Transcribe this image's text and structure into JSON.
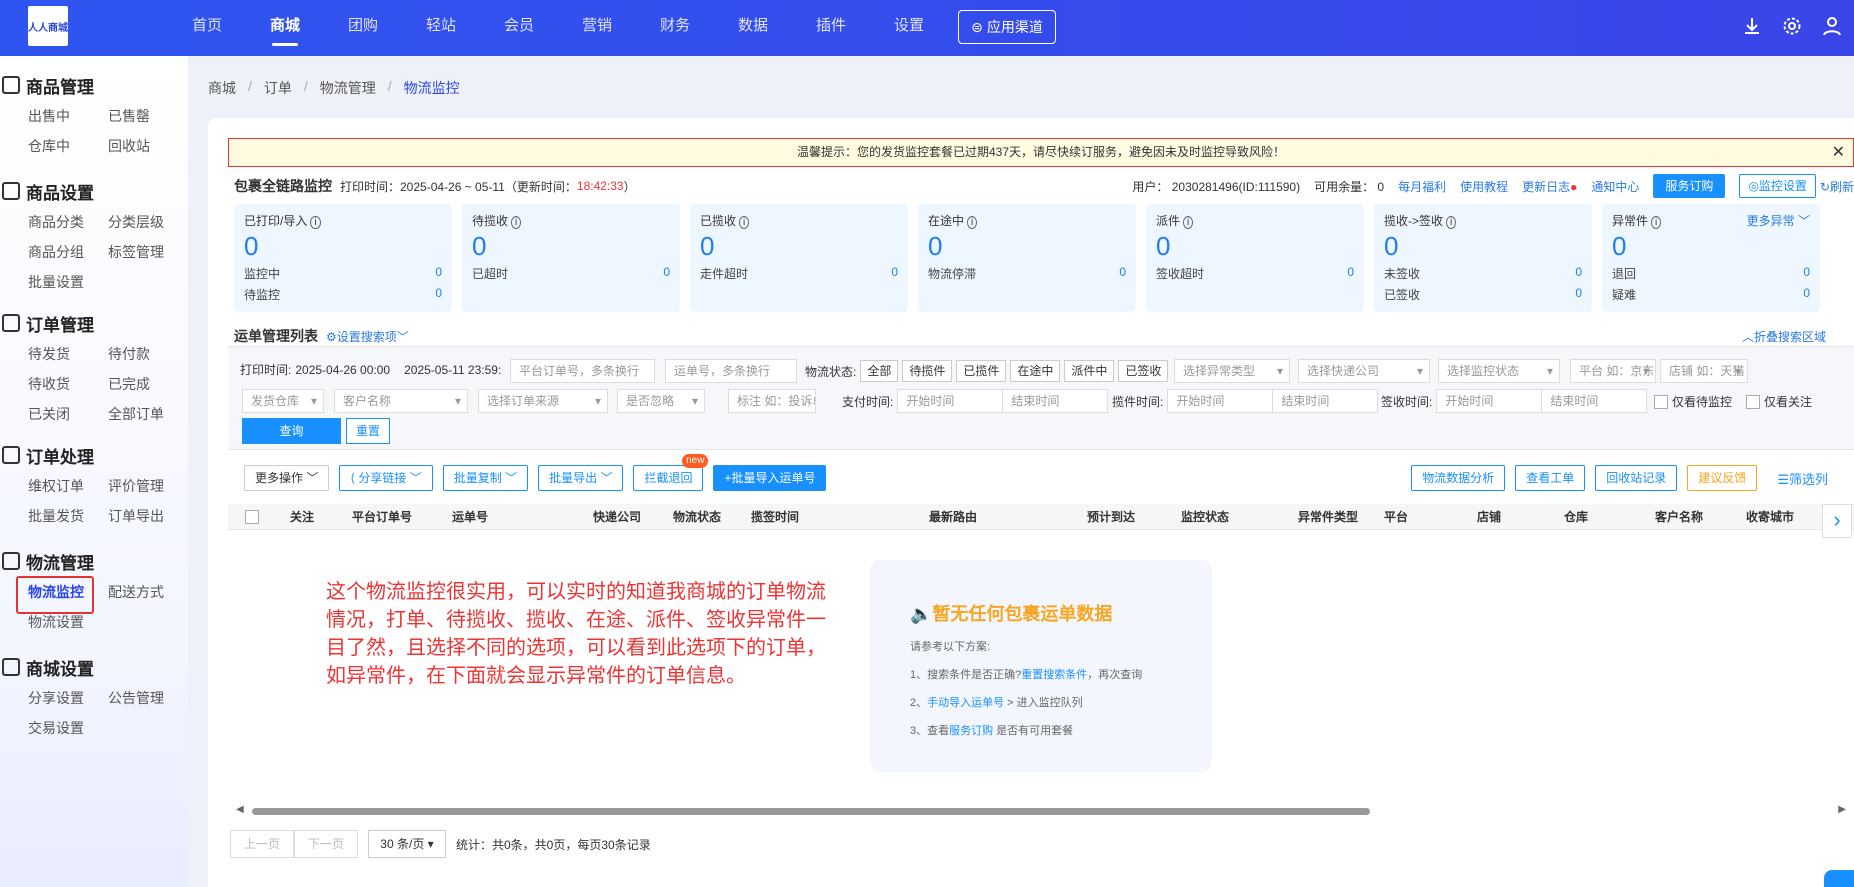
{
  "topbar": {
    "logo": "人人商城",
    "nav": [
      "首页",
      "商城",
      "团购",
      "轻站",
      "会员",
      "营销",
      "财务",
      "数据",
      "插件",
      "设置"
    ],
    "active": "商城",
    "app_button": "应用渠道",
    "icons": [
      "download-icon",
      "gear-icon",
      "user-icon"
    ]
  },
  "sidebar": {
    "sections": [
      {
        "title": "商品管理",
        "icon": "shop-icon",
        "items": [
          "出售中",
          "已售罄",
          "仓库中",
          "回收站"
        ]
      },
      {
        "title": "商品设置",
        "icon": "layers-icon",
        "items": [
          "商品分类",
          "分类层级",
          "商品分组",
          "标签管理",
          "批量设置"
        ]
      },
      {
        "title": "订单管理",
        "icon": "order-icon",
        "items": [
          "待发货",
          "待付款",
          "待收货",
          "已完成",
          "已关闭",
          "全部订单"
        ]
      },
      {
        "title": "订单处理",
        "icon": "document-icon",
        "items": [
          "维权订单",
          "评价管理",
          "批量发货",
          "订单导出"
        ]
      },
      {
        "title": "物流管理",
        "icon": "truck-icon",
        "items": [
          "物流监控",
          "配送方式",
          "物流设置"
        ],
        "active": "物流监控"
      },
      {
        "title": "商城设置",
        "icon": "settings-box-icon",
        "items": [
          "分享设置",
          "公告管理",
          "交易设置"
        ]
      }
    ]
  },
  "breadcrumb": [
    "商城",
    "订单",
    "物流管理",
    "物流监控"
  ],
  "warning": "温馨提示：您的发货监控套餐已过期437天，请尽快续订服务，避免因未及时监控导致风险！",
  "header": {
    "title": "包裹全链路监控",
    "print_time_label": "打印时间：2025-04-26 ~ 05-11",
    "update_label": "（更新时间：",
    "update_time": "18:42:33",
    "update_close": "）"
  },
  "right_info": {
    "user": "用户： 2030281496(ID:111590)",
    "balance": "可用余量： 0",
    "links": [
      "每月福利",
      "使用教程",
      "更新日志",
      "通知中心"
    ],
    "subscribe": "服务订购",
    "monitor_settings": "◎监控设置",
    "refresh": "刷新"
  },
  "cards": [
    {
      "title": "已打印/导入",
      "value": "0",
      "rows": [
        [
          "监控中",
          "0"
        ],
        [
          "待监控",
          "0"
        ]
      ]
    },
    {
      "title": "待揽收",
      "value": "0",
      "rows": [
        [
          "已超时",
          "0"
        ]
      ]
    },
    {
      "title": "已揽收",
      "value": "0",
      "rows": [
        [
          "走件超时",
          "0"
        ]
      ]
    },
    {
      "title": "在途中",
      "value": "0",
      "rows": [
        [
          "物流停滞",
          "0"
        ]
      ]
    },
    {
      "title": "派件",
      "value": "0",
      "rows": [
        [
          "签收超时",
          "0"
        ]
      ]
    },
    {
      "title": "揽收->签收",
      "value": "0",
      "rows": [
        [
          "未签收",
          "0"
        ],
        [
          "已签收",
          "0"
        ]
      ]
    },
    {
      "title": "异常件",
      "value": "0",
      "more": "更多异常",
      "rows": [
        [
          "退回",
          "0"
        ],
        [
          "疑难",
          "0"
        ]
      ]
    }
  ],
  "list": {
    "title": "运单管理列表",
    "search_settings": "设置搜索项",
    "fold": "折叠搜索区域"
  },
  "filters": {
    "print_time_label": "打印时间:",
    "print_start": "2025-04-26 00:00",
    "print_end": "2025-05-11 23:59:",
    "platform_order_ph": "平台订单号，多条换行",
    "waybill_ph": "运单号，多条换行",
    "status_label": "物流状态:",
    "status_tags": [
      "全部",
      "待揽件",
      "已揽件",
      "在途中",
      "派件中",
      "已签收"
    ],
    "selects1": [
      "选择异常类型",
      "选择快递公司",
      "选择监控状态",
      "平台 如：京东",
      "店铺 如：天猫"
    ],
    "selects2": [
      "发货仓库",
      "客户名称",
      "选择订单来源",
      "是否忽略"
    ],
    "mark_ph": "标注 如：投诉单",
    "pay_label": "支付时间:",
    "collect_label": "揽件时间:",
    "sign_label": "签收时间:",
    "start_ph": "开始时间",
    "end_ph": "结束时间",
    "only_pending": "仅看待监控",
    "only_follow": "仅看关注",
    "query": "查询",
    "reset": "重置"
  },
  "actions": {
    "left": [
      "更多操作",
      "分享链接",
      "批量复制",
      "批量导出",
      "拦截退回",
      "+批量导入运单号"
    ],
    "new_badge": "new",
    "right": [
      "物流数据分析",
      "查看工单",
      "回收站记录",
      "建议反馈",
      "筛选列"
    ]
  },
  "table": {
    "columns": [
      "关注",
      "平台订单号",
      "运单号",
      "快递公司",
      "物流状态",
      "揽签时间",
      "最新路由",
      "预计到达",
      "监控状态",
      "异常件类型",
      "平台",
      "店铺",
      "仓库",
      "客户名称",
      "收寄城市"
    ]
  },
  "annotation": "这个物流监控很实用，可以实时的知道我商城的订单物流情况，打单、待揽收、揽收、在途、派件、签收异常件一目了然，且选择不同的选项，可以看到此选项下的订单，如异常件，在下面就会显示异常件的订单信息。",
  "empty": {
    "title": "暂无任何包裹运单数据",
    "sub": "请参考以下方案:",
    "tips": [
      [
        "1、搜索条件是否正确?",
        "重置搜索条件",
        "，再次查询"
      ],
      [
        "2、",
        "手动导入运单号",
        " > 进入监控队列"
      ],
      [
        "3、查看",
        "服务订购",
        " 是否有可用套餐"
      ]
    ]
  },
  "pager": {
    "prev": "上一页",
    "next": "下一页",
    "size": "30 条/页",
    "stats": "统计：共0条，共0页，每页30条记录"
  }
}
